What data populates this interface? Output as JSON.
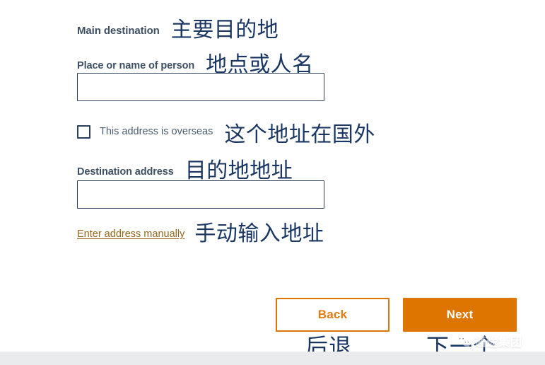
{
  "form": {
    "section_heading": {
      "en": "Main destination",
      "cn": "主要目的地"
    },
    "place_field": {
      "en_label": "Place or name of person",
      "cn_label": "地点或人名",
      "value": "",
      "placeholder": ""
    },
    "overseas_checkbox": {
      "en_label": "This address is overseas",
      "cn_label": "这个地址在国外",
      "checked": false
    },
    "address_field": {
      "en_label": "Destination address",
      "cn_label": "目的地地址",
      "value": "",
      "placeholder": ""
    },
    "manual_link": {
      "en_label": "Enter address manually",
      "cn_label": "手动输入地址"
    }
  },
  "actions": {
    "back": {
      "en_label": "Back",
      "cn_label": "后退"
    },
    "next": {
      "en_label": "Next",
      "cn_label": "下一个"
    }
  },
  "watermark": {
    "icon": "wechat-icon",
    "text": "通途集团"
  },
  "colors": {
    "en_label": "#3d4f63",
    "cn_annotation": "#1a3663",
    "input_border": "#2c4159",
    "accent_orange": "#dd7500",
    "link": "#93661b",
    "footer_strip": "#eaebec"
  }
}
